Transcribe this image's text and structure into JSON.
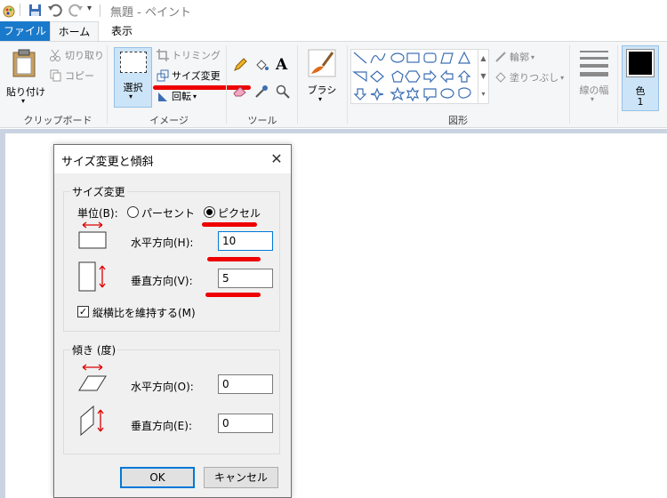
{
  "window": {
    "title": "無題 - ペイント"
  },
  "tabs": {
    "file": "ファイル",
    "home": "ホーム",
    "view": "表示"
  },
  "ribbon": {
    "clipboard": {
      "paste": "貼り付け",
      "cut": "切り取り",
      "copy": "コピー",
      "group": "クリップボード"
    },
    "image": {
      "select": "選択",
      "crop": "トリミング",
      "resize": "サイズ変更",
      "rotate": "回転",
      "group": "イメージ"
    },
    "tools": {
      "group": "ツール"
    },
    "brush": {
      "label": "ブラシ"
    },
    "shapes": {
      "outline": "輪郭",
      "fill": "塗りつぶし",
      "group": "図形"
    },
    "size": {
      "label": "線の幅"
    },
    "color": {
      "label": "色",
      "index": "1",
      "value": "#000000"
    }
  },
  "dialog": {
    "title": "サイズ変更と傾斜",
    "resize": {
      "legend": "サイズ変更",
      "unit_label": "単位(B):",
      "percent_label": "パーセント",
      "pixel_label": "ピクセル",
      "selected_unit": "pixel",
      "horizontal_label": "水平方向(H):",
      "horizontal_value": "10",
      "vertical_label": "垂直方向(V):",
      "vertical_value": "5",
      "keep_ratio_label": "縦横比を維持する(M)",
      "keep_ratio_checked": true
    },
    "skew": {
      "legend": "傾き (度)",
      "horizontal_label": "水平方向(O):",
      "horizontal_value": "0",
      "vertical_label": "垂直方向(E):",
      "vertical_value": "0"
    },
    "ok": "OK",
    "cancel": "キャンセル"
  },
  "colors": {
    "accent": "#1979ca",
    "annotation": "#ee0000",
    "focus": "#0078d7"
  }
}
